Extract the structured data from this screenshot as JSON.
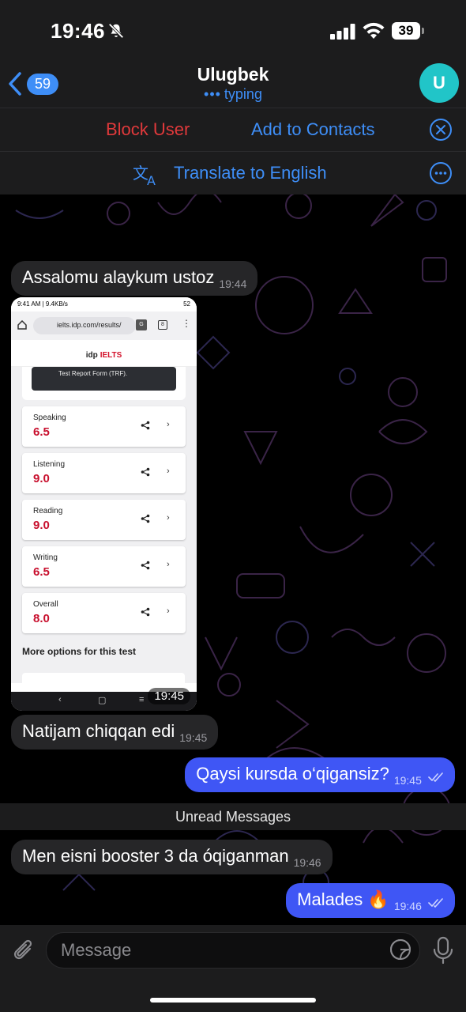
{
  "status_bar": {
    "time": "19:46",
    "battery": "39"
  },
  "header": {
    "back_count": "59",
    "title": "Ulugbek",
    "status": "typing",
    "avatar_letter": "U"
  },
  "actions": {
    "block_user": "Block User",
    "add_to_contacts": "Add to Contacts"
  },
  "translate": {
    "label": "Translate to English"
  },
  "messages": [
    {
      "direction": "in",
      "text": "Assalomu alaykum ustoz",
      "time": "19:44"
    },
    {
      "direction": "in",
      "type": "photo",
      "time": "19:45"
    },
    {
      "direction": "in",
      "text": "Natijam chiqqan edi",
      "time": "19:45"
    },
    {
      "direction": "out",
      "text": "Qaysi kursda o‘qigansiz?",
      "time": "19:45",
      "read": true
    },
    {
      "direction": "in",
      "text": "Men eisni booster 3 da óqiganman",
      "time": "19:46"
    },
    {
      "direction": "out",
      "text": "Malades 🔥",
      "time": "19:46",
      "read": true
    }
  ],
  "unread_label": "Unread Messages",
  "photo": {
    "status_time": "9:41 AM | 9.4KB/s",
    "status_battery": "52",
    "url": "ielts.idp.com/results/",
    "tab_count": "8",
    "logo_idp": "idp",
    "logo_ielts": "IELTS",
    "trf_text": "Test Report Form (TRF).",
    "scores": [
      {
        "label": "Speaking",
        "value": "6.5"
      },
      {
        "label": "Listening",
        "value": "9.0"
      },
      {
        "label": "Reading",
        "value": "9.0"
      },
      {
        "label": "Writing",
        "value": "6.5"
      },
      {
        "label": "Overall",
        "value": "8.0"
      }
    ],
    "more_options": "More options for this test"
  },
  "input": {
    "placeholder": "Message"
  },
  "colors": {
    "accent": "#3e8ef7",
    "danger": "#e0393b",
    "outgoing_bubble": "#3f56f5",
    "incoming_bubble": "#262628",
    "avatar": "#21c5c8",
    "ielts_red": "#c8102e"
  }
}
